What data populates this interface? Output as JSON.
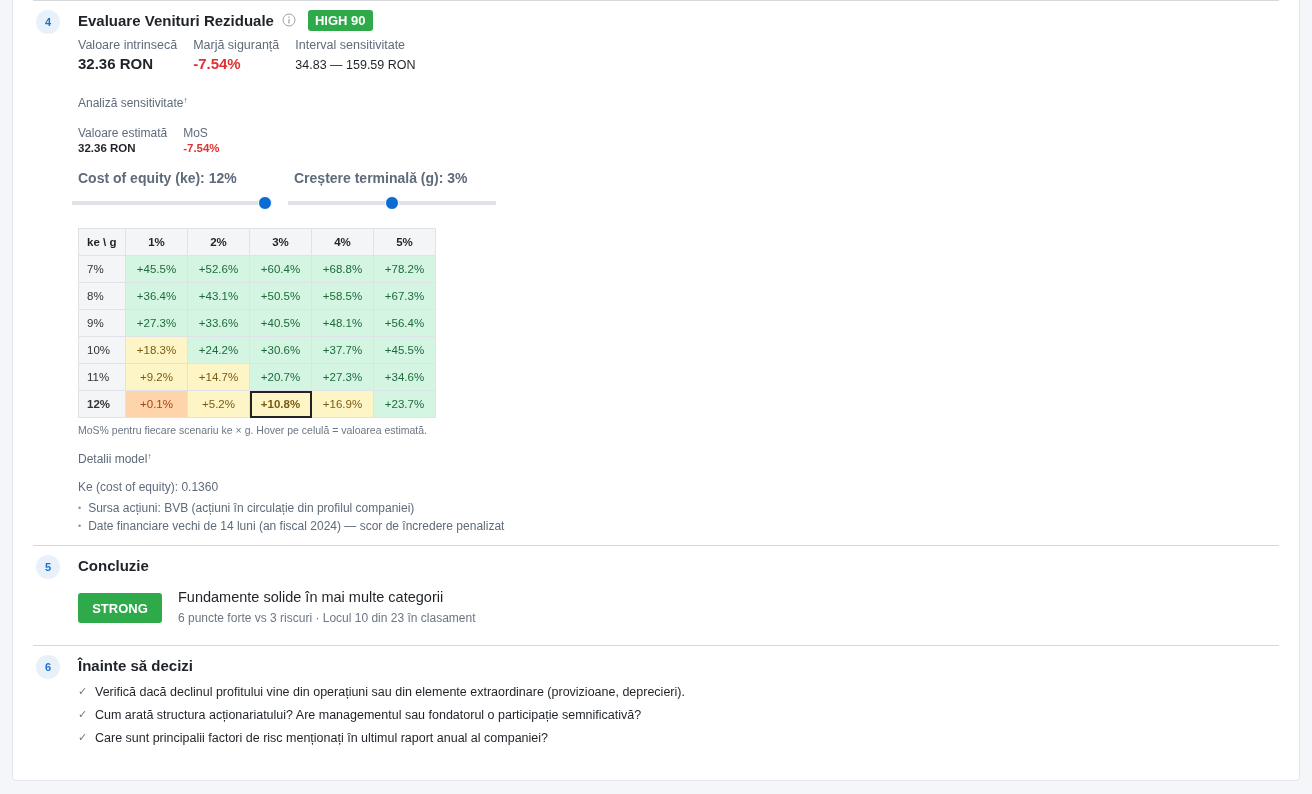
{
  "sections": [
    {
      "number": "4",
      "title": "Evaluare Venituri Reziduale",
      "badge": "HIGH 90",
      "metrics": [
        {
          "label": "Valoare intrinsecă",
          "value": "32.36 RON",
          "kind": "big"
        },
        {
          "label": "Marjă siguranță",
          "value": "-7.54%",
          "kind": "negative"
        },
        {
          "label": "Interval sensitivitate",
          "value": "34.83 — 159.59 RON",
          "kind": "plain"
        }
      ],
      "sensitivity": {
        "title": "Analiză sensitivitate",
        "toggle": "↑",
        "estimates": [
          {
            "label": "Valoare estimată",
            "value": "32.36 RON",
            "kind": "plain"
          },
          {
            "label": "MoS",
            "value": "-7.54%",
            "kind": "negative"
          }
        ],
        "sliders": [
          {
            "label": "Cost of equity (ke): 12%",
            "level": 1.0
          },
          {
            "label": "Creștere terminală (g): 3%",
            "level": 0.5
          }
        ],
        "table": {
          "corner": "ke \\ g",
          "columns": [
            "1%",
            "2%",
            "3%",
            "4%",
            "5%"
          ],
          "rows": [
            {
              "label": "7%",
              "selected": false,
              "cells": [
                {
                  "text": "+45.5%",
                  "kind": "high",
                  "selected": false
                },
                {
                  "text": "+52.6%",
                  "kind": "high",
                  "selected": false
                },
                {
                  "text": "+60.4%",
                  "kind": "high",
                  "selected": false
                },
                {
                  "text": "+68.8%",
                  "kind": "high",
                  "selected": false
                },
                {
                  "text": "+78.2%",
                  "kind": "high",
                  "selected": false
                }
              ]
            },
            {
              "label": "8%",
              "selected": false,
              "cells": [
                {
                  "text": "+36.4%",
                  "kind": "high",
                  "selected": false
                },
                {
                  "text": "+43.1%",
                  "kind": "high",
                  "selected": false
                },
                {
                  "text": "+50.5%",
                  "kind": "high",
                  "selected": false
                },
                {
                  "text": "+58.5%",
                  "kind": "high",
                  "selected": false
                },
                {
                  "text": "+67.3%",
                  "kind": "high",
                  "selected": false
                }
              ]
            },
            {
              "label": "9%",
              "selected": false,
              "cells": [
                {
                  "text": "+27.3%",
                  "kind": "high",
                  "selected": false
                },
                {
                  "text": "+33.6%",
                  "kind": "high",
                  "selected": false
                },
                {
                  "text": "+40.5%",
                  "kind": "high",
                  "selected": false
                },
                {
                  "text": "+48.1%",
                  "kind": "high",
                  "selected": false
                },
                {
                  "text": "+56.4%",
                  "kind": "high",
                  "selected": false
                }
              ]
            },
            {
              "label": "10%",
              "selected": false,
              "cells": [
                {
                  "text": "+18.3%",
                  "kind": "mid",
                  "selected": false
                },
                {
                  "text": "+24.2%",
                  "kind": "high",
                  "selected": false
                },
                {
                  "text": "+30.6%",
                  "kind": "high",
                  "selected": false
                },
                {
                  "text": "+37.7%",
                  "kind": "high",
                  "selected": false
                },
                {
                  "text": "+45.5%",
                  "kind": "high",
                  "selected": false
                }
              ]
            },
            {
              "label": "11%",
              "selected": false,
              "cells": [
                {
                  "text": "+9.2%",
                  "kind": "mid",
                  "selected": false
                },
                {
                  "text": "+14.7%",
                  "kind": "mid",
                  "selected": false
                },
                {
                  "text": "+20.7%",
                  "kind": "high",
                  "selected": false
                },
                {
                  "text": "+27.3%",
                  "kind": "high",
                  "selected": false
                },
                {
                  "text": "+34.6%",
                  "kind": "high",
                  "selected": false
                }
              ]
            },
            {
              "label": "12%",
              "selected": true,
              "cells": [
                {
                  "text": "+0.1%",
                  "kind": "low",
                  "selected": false
                },
                {
                  "text": "+5.2%",
                  "kind": "mid",
                  "selected": false
                },
                {
                  "text": "+10.8%",
                  "kind": "mid",
                  "selected": true
                },
                {
                  "text": "+16.9%",
                  "kind": "mid",
                  "selected": false
                },
                {
                  "text": "+23.7%",
                  "kind": "high",
                  "selected": false
                }
              ]
            }
          ]
        },
        "note": "MoS% pentru fiecare scenariu ke × g. Hover pe celulă = valoarea estimată."
      },
      "details": {
        "title": "Detalii model",
        "toggle": "↑",
        "line": "Ke (cost of equity): 0.1360",
        "bullets": [
          {
            "marker": "•",
            "text": "Sursa acțiuni: BVB (acțiuni în circulație din profilul companiei)"
          },
          {
            "marker": "•",
            "text": "Date financiare vechi de 14 luni (an fiscal 2024) — scor de încredere penalizat"
          }
        ]
      }
    },
    {
      "number": "5",
      "title": "Concluzie",
      "verdict": "STRONG",
      "headline": "Fundamente solide în mai multe categorii",
      "subline": "6 puncte forte vs 3 riscuri · Locul 10 din 23 în clasament"
    },
    {
      "number": "6",
      "title": "Înainte să decizi",
      "checks": [
        {
          "mark": "✓",
          "text": "Verifică dacă declinul profitului vine din operațiuni sau din elemente extraordinare (provizioane, deprecieri)."
        },
        {
          "mark": "✓",
          "text": "Cum arată structura acționariatului? Are managementul sau fondatorul o participație semnificativă?"
        },
        {
          "mark": "✓",
          "text": "Care sunt principalii factori de risc menționați în ultimul raport anual al companiei?"
        }
      ]
    }
  ]
}
